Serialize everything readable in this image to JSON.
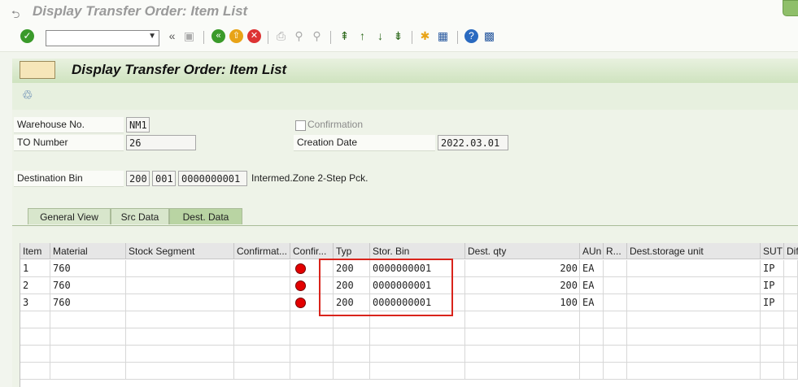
{
  "window": {
    "title": "Display Transfer Order: Item List"
  },
  "toolbar": {
    "command_value": "",
    "icons": [
      "enter-icon",
      "back-double-icon",
      "save-icon",
      "back-icon",
      "exit-icon",
      "cancel-icon",
      "print-icon",
      "find-icon",
      "find-next-icon",
      "first-page-icon",
      "prev-page-icon",
      "next-page-icon",
      "last-page-icon",
      "create-session-icon",
      "shortcut-icon",
      "help-icon",
      "customize-icon"
    ]
  },
  "screen": {
    "title": "Display Transfer Order: Item List"
  },
  "header": {
    "warehouse_label": "Warehouse No.",
    "warehouse_value": "NM1",
    "to_label": "TO Number",
    "to_value": "26",
    "confirmation_label": "Confirmation",
    "creation_label": "Creation Date",
    "creation_value": "2022.03.01",
    "dest_bin_label": "Destination Bin",
    "dest_bin_type": "200",
    "dest_bin_section": "001",
    "dest_bin_value": "0000000001",
    "dest_bin_desc": "Intermed.Zone 2-Step Pck."
  },
  "tabs": [
    {
      "label": "General View"
    },
    {
      "label": "Src Data"
    },
    {
      "label": "Dest. Data"
    }
  ],
  "table": {
    "columns": [
      "Item",
      "Material",
      "Stock Segment",
      "Confirmat...",
      "Confir...",
      "Typ",
      "Stor. Bin",
      "Dest. qty",
      "AUn",
      "R...",
      "Dest.storage unit",
      "SUT",
      "Dif"
    ],
    "rows": [
      {
        "item": "1",
        "material": "760",
        "typ": "200",
        "bin": "0000000001",
        "qty": "200",
        "aun": "EA",
        "sut": "IP"
      },
      {
        "item": "2",
        "material": "760",
        "typ": "200",
        "bin": "0000000001",
        "qty": "200",
        "aun": "EA",
        "sut": "IP"
      },
      {
        "item": "3",
        "material": "760",
        "typ": "200",
        "bin": "0000000001",
        "qty": "100",
        "aun": "EA",
        "sut": "IP"
      }
    ]
  },
  "colors": {
    "status_red": "#e30000",
    "highlight": "#d9241c",
    "header_green": "#cfe3bf"
  }
}
